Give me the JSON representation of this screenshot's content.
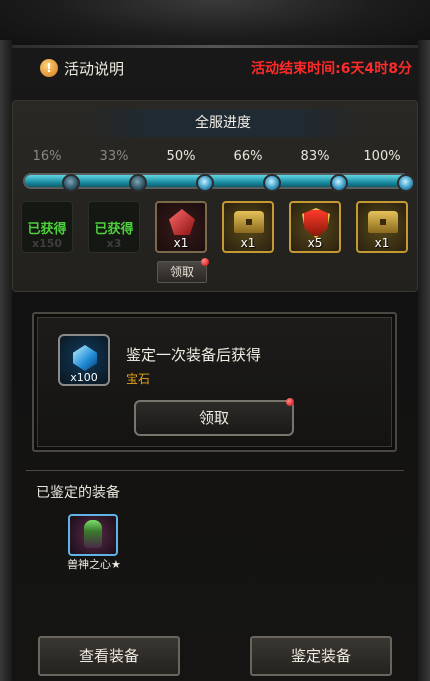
{
  "header": {
    "info_icon": "exclamation-icon",
    "info_label": "活动说明",
    "countdown": "活动结束时间:6天4时8分"
  },
  "progress": {
    "title": "全服进度",
    "percent_labels": [
      "16%",
      "33%",
      "50%",
      "66%",
      "83%",
      "100%"
    ],
    "fill_fraction": 1.0,
    "rewards": [
      {
        "state": "claimed",
        "label": "已获得",
        "qty": "x150"
      },
      {
        "state": "claimed",
        "label": "已获得",
        "qty": "x3"
      },
      {
        "state": "available",
        "icon": "red-gem-icon",
        "qty": "x1",
        "claim_label": "领取"
      },
      {
        "state": "locked",
        "icon": "treasure-chest-icon",
        "qty": "x1"
      },
      {
        "state": "locked",
        "icon": "shield-emblem-icon",
        "qty": "x5"
      },
      {
        "state": "locked",
        "icon": "treasure-chest-icon",
        "qty": "x1"
      }
    ]
  },
  "identify_card": {
    "icon": "blue-crystal-icon",
    "qty": "x100",
    "title": "鉴定一次装备后获得",
    "subtitle": "宝石",
    "claim_label": "领取"
  },
  "identified": {
    "label": "已鉴定的装备",
    "items": [
      {
        "name": "兽神之心★",
        "icon": "beast-heart-icon"
      }
    ]
  },
  "buttons": {
    "view": "查看装备",
    "identify": "鉴定装备"
  },
  "colors": {
    "countdown": "#ff2a2a",
    "claimed_text": "#4bd13b",
    "subtitle": "#e6a21a",
    "progress_fill": "#1b8ea3"
  }
}
